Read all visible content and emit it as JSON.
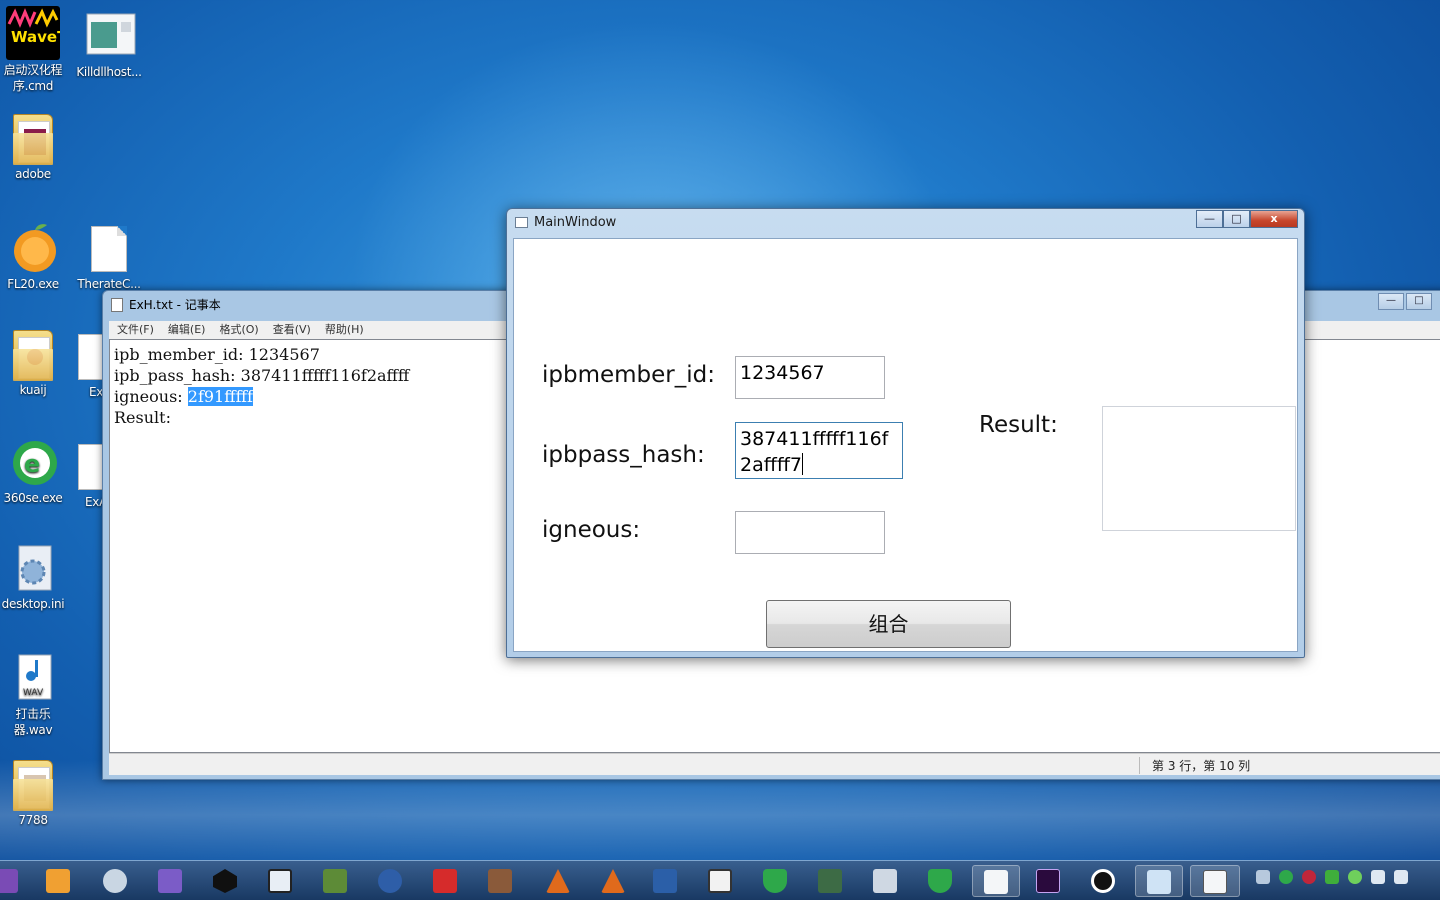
{
  "desktop": {
    "icons": [
      {
        "label": "启动汉化程序.cmd"
      },
      {
        "label": "Killdllhost..."
      },
      {
        "label": "adobe"
      },
      {
        "label": "FL20.exe"
      },
      {
        "label": "TherateC..."
      },
      {
        "label": "kuaij"
      },
      {
        "label": "Ex"
      },
      {
        "label": "360se.exe"
      },
      {
        "label": "ExA"
      },
      {
        "label": "desktop.ini"
      },
      {
        "label": "打击乐器.wav"
      },
      {
        "label": "7788"
      }
    ],
    "wavetone_logo": "WaveTone",
    "wav_badge": "WAV"
  },
  "notepad": {
    "title": "ExH.txt - 记事本",
    "menu": [
      "文件(F)",
      "编辑(E)",
      "格式(O)",
      "查看(V)",
      "帮助(H)"
    ],
    "lines": {
      "l1": "ipb_member_id: 1234567",
      "l2": "ipb_pass_hash: 387411fffff116f2affff",
      "l3_prefix": "igneous: ",
      "l3_selected": "2f91fffff",
      "l4": "Result:"
    },
    "status": "第 3 行，第 10 列",
    "controls": {
      "min": "—",
      "max": "□"
    }
  },
  "mainwindow": {
    "title": "MainWindow",
    "controls": {
      "min": "—",
      "max": "□",
      "close": "x"
    },
    "labels": {
      "member_id": "ipbmember_id:",
      "pass_hash": "ipbpass_hash:",
      "igneous": "igneous:",
      "result": "Result:"
    },
    "fields": {
      "member_id": "1234567",
      "pass_hash_line1": "387411fffff116f",
      "pass_hash_line2": "2affff7",
      "igneous": "",
      "result": ""
    },
    "button": "组合"
  },
  "taskbar": {
    "apps": [
      "media-player",
      "vlc",
      "finder",
      "visual-studio",
      "unity",
      "virtualbox",
      "minecraft",
      "cinema4d",
      "wps",
      "minecraft-2",
      "matlab",
      "matlab-2",
      "powershell",
      "package",
      "360-safe",
      "monitor",
      "calculator",
      "360-safe-2",
      "notepad-window",
      "premiere",
      "obs",
      "mainwindow-app",
      "notepad"
    ],
    "colors": {
      "premiere": "#2a0a3d",
      "obs": "#111111",
      "matlab": "#e06a1c",
      "minecraft": "#5d8b37"
    }
  }
}
